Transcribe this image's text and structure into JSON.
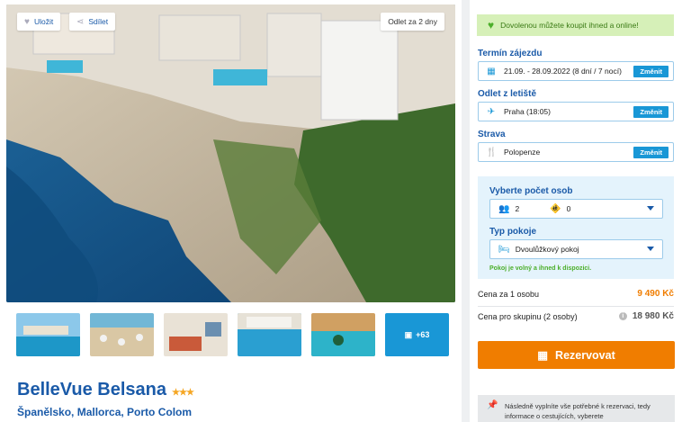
{
  "hero": {
    "save_label": "Uložit",
    "share_label": "Sdílet",
    "badge": "Odlet za 2 dny"
  },
  "gallery": {
    "more_label": "+63"
  },
  "hotel": {
    "name": "BelleVue Belsana",
    "stars": "★★★",
    "location": "Španělsko, Mallorca, Porto Colom"
  },
  "booking": {
    "notice": "Dovolenou můžete koupit ihned a online!",
    "term_label": "Termín zájezdu",
    "term_value": "21.09. - 28.09.2022 (8 dní / 7 nocí)",
    "departure_label": "Odlet z letiště",
    "departure_value": "Praha (18:05)",
    "board_label": "Strava",
    "board_value": "Polopenze",
    "change_label": "Změnit",
    "persons_label": "Vyberte počet osob",
    "adults": "2",
    "children": "0",
    "room_label": "Typ pokoje",
    "room_value": "Dvoulůžkový pokoj",
    "availability": "Pokoj je volný a ihned k dispozici.",
    "price_person_label": "Cena za 1 osobu",
    "price_person": "9 490 Kč",
    "price_group_label": "Cena pro skupinu (2 osoby)",
    "price_group": "18 980 Kč",
    "reserve_label": "Rezervovat",
    "note": "Následně vyplníte vše potřebné k rezervaci, tedy informace o cestujících, vyberete"
  },
  "colors": {
    "brand": "#1a5aa8",
    "accent": "#1997d6",
    "cta": "#f07d00",
    "success": "#4caf2a"
  }
}
